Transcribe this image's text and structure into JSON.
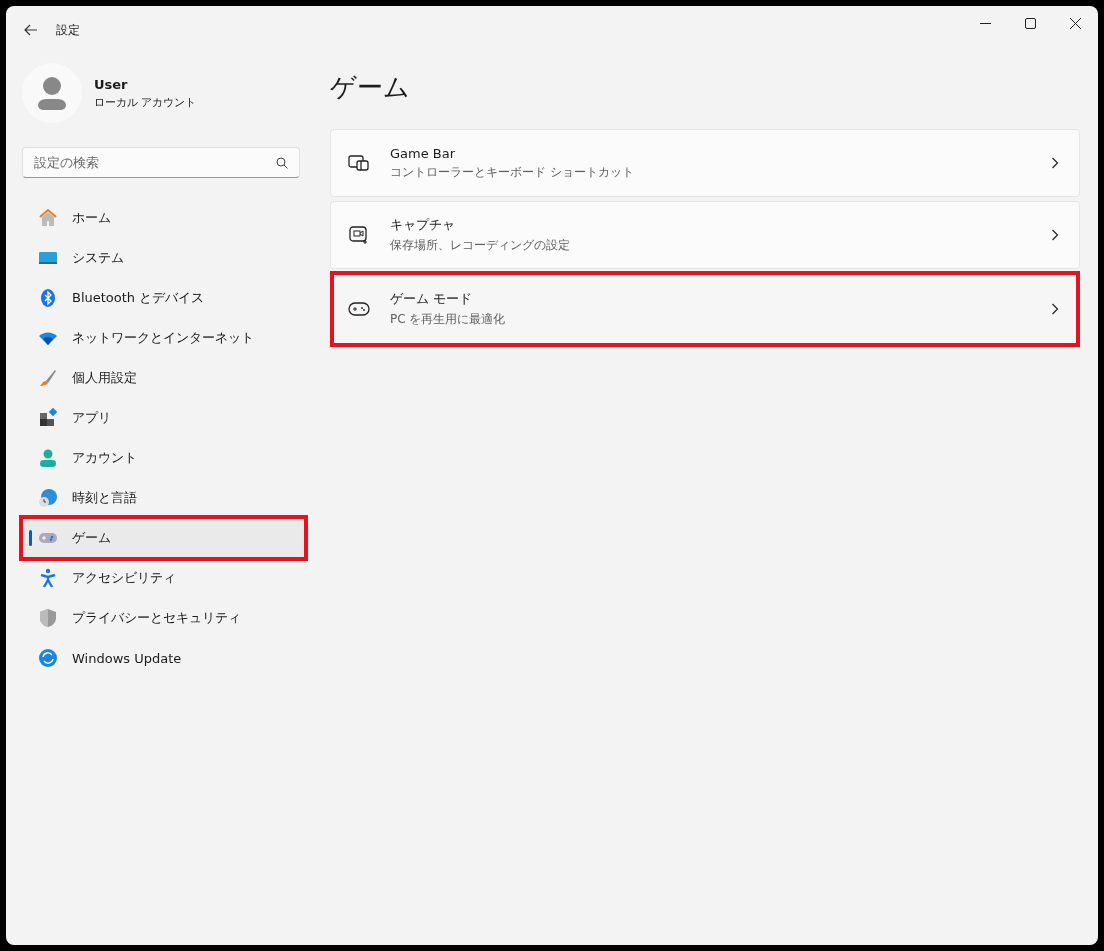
{
  "window": {
    "title": "設定"
  },
  "user": {
    "name": "User",
    "account": "ローカル アカウント"
  },
  "search": {
    "placeholder": "設定の検索"
  },
  "nav": [
    {
      "label": "ホーム",
      "selected": false,
      "highlighted": false
    },
    {
      "label": "システム",
      "selected": false,
      "highlighted": false
    },
    {
      "label": "Bluetooth とデバイス",
      "selected": false,
      "highlighted": false
    },
    {
      "label": "ネットワークとインターネット",
      "selected": false,
      "highlighted": false
    },
    {
      "label": "個人用設定",
      "selected": false,
      "highlighted": false
    },
    {
      "label": "アプリ",
      "selected": false,
      "highlighted": false
    },
    {
      "label": "アカウント",
      "selected": false,
      "highlighted": false
    },
    {
      "label": "時刻と言語",
      "selected": false,
      "highlighted": false
    },
    {
      "label": "ゲーム",
      "selected": true,
      "highlighted": true
    },
    {
      "label": "アクセシビリティ",
      "selected": false,
      "highlighted": false
    },
    {
      "label": "プライバシーとセキュリティ",
      "selected": false,
      "highlighted": false
    },
    {
      "label": "Windows Update",
      "selected": false,
      "highlighted": false
    }
  ],
  "page": {
    "title": "ゲーム"
  },
  "cards": [
    {
      "title": "Game Bar",
      "subtitle": "コントローラーとキーボード ショートカット",
      "highlighted": false
    },
    {
      "title": "キャプチャ",
      "subtitle": "保存場所、レコーディングの設定",
      "highlighted": false
    },
    {
      "title": "ゲーム モード",
      "subtitle": "PC を再生用に最適化",
      "highlighted": true
    }
  ]
}
